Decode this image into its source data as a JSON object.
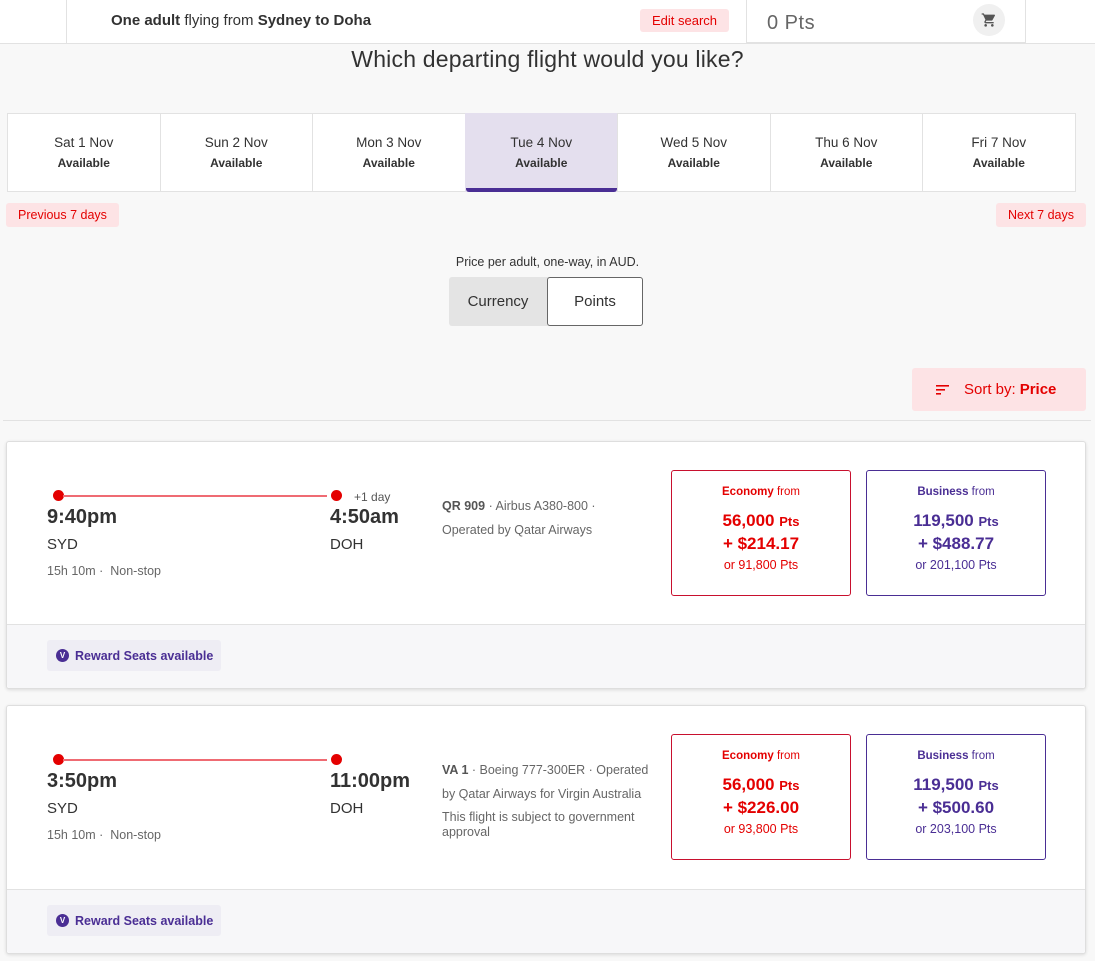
{
  "header": {
    "summary": {
      "count": "One adult",
      "middle": " flying from ",
      "route": "Sydney to Doha"
    },
    "edit_search_label": "Edit search",
    "points_balance": "0 Pts",
    "cart_icon": "shopping-cart-icon"
  },
  "page_title": "Which departing flight would you like?",
  "date_tabs": [
    {
      "date": "Sat 1 Nov",
      "status": "Available",
      "selected": false
    },
    {
      "date": "Sun 2 Nov",
      "status": "Available",
      "selected": false
    },
    {
      "date": "Mon 3 Nov",
      "status": "Available",
      "selected": false
    },
    {
      "date": "Tue 4 Nov",
      "status": "Available",
      "selected": true
    },
    {
      "date": "Wed 5 Nov",
      "status": "Available",
      "selected": false
    },
    {
      "date": "Thu 6 Nov",
      "status": "Available",
      "selected": false
    },
    {
      "date": "Fri 7 Nov",
      "status": "Available",
      "selected": false
    }
  ],
  "nav": {
    "previous_label": "Previous 7 days",
    "next_label": "Next 7 days"
  },
  "price_note": "Price per adult, one-way, in AUD.",
  "price_toggle": {
    "options": [
      "Currency",
      "Points"
    ],
    "selected": "Points"
  },
  "sort": {
    "prefix": "Sort by:",
    "value": "Price",
    "icon": "sort-icon"
  },
  "flights": [
    {
      "departure_time": "9:40pm",
      "departure_airport": "SYD",
      "arrival_time": "4:50am",
      "arrival_airport": "DOH",
      "day_offset": "+1 day",
      "duration": "15h 10m",
      "stops": "Non-stop",
      "flight_number": "QR 909",
      "aircraft": "Airbus A380-800",
      "operator": "Operated by Qatar Airways",
      "note": "",
      "economy": {
        "label": "Economy",
        "from": "from",
        "points": "56,000",
        "pts_unit": "Pts",
        "cash": "+ $214.17",
        "alt": "or 91,800 Pts"
      },
      "business": {
        "label": "Business",
        "from": "from",
        "points": "119,500",
        "pts_unit": "Pts",
        "cash": "+ $488.77",
        "alt": "or 201,100 Pts"
      },
      "badge": "Reward Seats available"
    },
    {
      "departure_time": "3:50pm",
      "departure_airport": "SYD",
      "arrival_time": "11:00pm",
      "arrival_airport": "DOH",
      "day_offset": "",
      "duration": "15h 10m",
      "stops": "Non-stop",
      "flight_number": "VA 1",
      "aircraft": "Boeing 777-300ER",
      "operator": "Operated by Qatar Airways for Virgin Australia",
      "note": "This flight is subject to government approval",
      "economy": {
        "label": "Economy",
        "from": "from",
        "points": "56,000",
        "pts_unit": "Pts",
        "cash": "+ $226.00",
        "alt": "or 93,800 Pts"
      },
      "business": {
        "label": "Business",
        "from": "from",
        "points": "119,500",
        "pts_unit": "Pts",
        "cash": "+ $500.60",
        "alt": "or 203,100 Pts"
      },
      "badge": "Reward Seats available"
    }
  ],
  "colors": {
    "brand_red": "#e40000",
    "brand_purple": "#4a2e94",
    "selected_tab_bg": "#e4dfee",
    "pill_bg": "#fde3e5"
  }
}
